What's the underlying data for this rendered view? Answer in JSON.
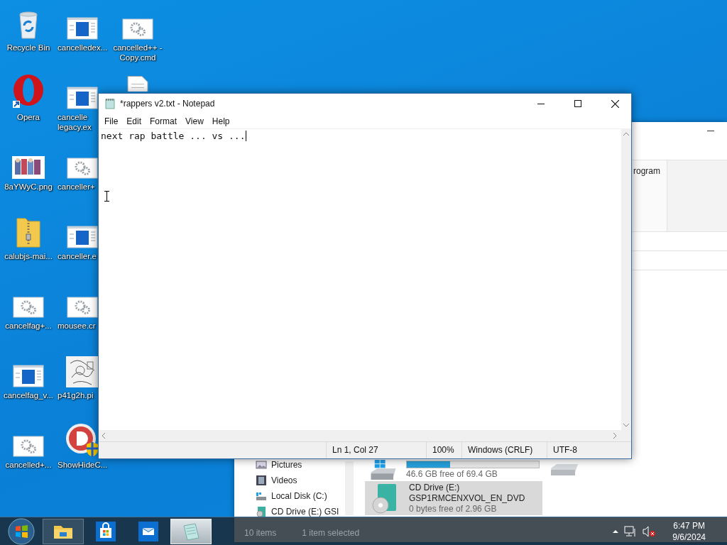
{
  "desktop_columns": [
    [
      {
        "label": "Recycle Bin",
        "kind": "recycle"
      },
      {
        "label": "Opera",
        "kind": "opera"
      },
      {
        "label": "8aYWyC.png"
      },
      {
        "label": "calubjs-mai...",
        "kind": "zip"
      },
      {
        "label": "cancelfag+...",
        "kind": "gear"
      },
      {
        "label": "cancelfag_v...",
        "kind": "app"
      },
      {
        "label": "cancelled+...",
        "kind": "gear"
      }
    ],
    [
      {
        "label": "cancelledex...",
        "kind": "app"
      },
      {
        "label": "cancelle legacy.ex",
        "kind": "app"
      },
      {
        "label": "canceller+",
        "kind": "gear"
      },
      {
        "label": "canceller.e",
        "kind": "app"
      },
      {
        "label": "mousee.cr",
        "kind": "gear"
      },
      {
        "label": "p41g2h.pi",
        "kind": "sketch"
      },
      {
        "label": "ShowHideC...",
        "kind": "shield"
      }
    ],
    [
      {
        "label": "cancelled++ - Copy.cmd",
        "kind": "gear"
      },
      {
        "kind": "doc"
      }
    ]
  ],
  "explorer": {
    "ribbon_text": "rogram",
    "nav_items": [
      {
        "label": "Pictures",
        "kind": "pictures"
      },
      {
        "label": "Videos",
        "kind": "videos"
      },
      {
        "label": "Local Disk (C:)",
        "kind": "disk"
      },
      {
        "label": "CD Drive (E:) GSI",
        "kind": "cd"
      }
    ],
    "drives": [
      {
        "kind": "disk",
        "selected": false,
        "level": 0.33,
        "free": "46.6 GB free of 69.4 GB"
      },
      {
        "kind": "cd",
        "selected": true,
        "name": "CD Drive (E:)",
        "label": "GSP1RMCENXVOL_EN_DVD",
        "free": "0 bytes free of 2.96 GB"
      }
    ],
    "status": [
      "10 items",
      "1 item selected"
    ]
  },
  "notepad": {
    "title": "*rappers v2.txt - Notepad",
    "menu": [
      "File",
      "Edit",
      "Format",
      "View",
      "Help"
    ],
    "text": "next rap battle ... vs ...",
    "status": [
      "Ln 1, Col 27",
      "100%",
      "Windows (CRLF)",
      "UTF-8"
    ]
  },
  "taskbar": {
    "apps": [
      {
        "kind": "explorer",
        "active": false
      },
      {
        "kind": "store",
        "active": false
      },
      {
        "kind": "mail",
        "active": false
      },
      {
        "kind": "notepad",
        "active": true
      }
    ],
    "time": "6:47 PM",
    "date": "9/6/2024"
  }
}
